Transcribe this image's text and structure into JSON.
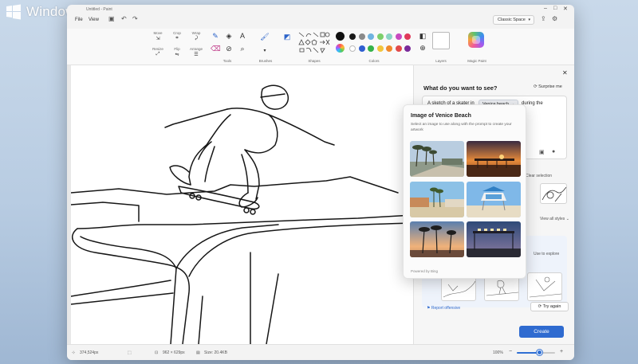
{
  "watermark": {
    "text": "Windows Central"
  },
  "titlebar": {
    "caption": "Untitled - Paint",
    "menu": [
      "File",
      "View"
    ],
    "mode": "Classic Space"
  },
  "ribbon": {
    "image_tools": [
      "Move",
      "Crop",
      "Wrap",
      "Resize",
      "Flip",
      "Arrange"
    ],
    "groups": {
      "tools": "Tools",
      "brushes": "Brushes",
      "shapes": "Shapes",
      "colors": "Colors",
      "layers": "Layers",
      "magic": "Magic Paint"
    },
    "colors_row1": [
      "#1a1a1a",
      "#8a8a8a",
      "#6fb3e0",
      "#7ccf6b",
      "#8bd4c5",
      "#c84ac0",
      "#e03a5a"
    ],
    "colors_row2": [
      "#ffffff",
      "#2f5fd0",
      "#35b24a",
      "#f2c53d",
      "#f08a2d",
      "#e24a4a",
      "#7a2a9a"
    ]
  },
  "canvas": {
    "subject": "line sketch of a skateboarder jumping at Venice beach skatepark"
  },
  "statusbar": {
    "cursor": "374,524px",
    "dimensions": "962 × 629px",
    "size": "Size: 20.4KB",
    "zoom": "100%",
    "zoom_level": 0.6
  },
  "panel": {
    "title": "What do you want to see?",
    "surprise": "Surprise me",
    "prompt_prefix": "A sketch of a skater in",
    "prompt_chip": "Venice beach",
    "prompt_suffix": "during the",
    "clear_selection": "Clear selection",
    "view_all_styles": "View all styles",
    "explore_hint": "Use to explore",
    "report": "Report offensive",
    "try_again": "Try again",
    "create": "Create"
  },
  "popup": {
    "title": "Image of Venice Beach",
    "subtitle": "Select an image to use along with the prompt to create your artwork",
    "footer": "Powered by Bing",
    "photos": [
      "palm-trees-beach-path",
      "sunset-pier",
      "beach-boardwalk",
      "lifeguard-tower",
      "palm-trees-sunset",
      "venice-sign-night"
    ]
  },
  "colors": {
    "accent": "#2f6bd0",
    "background": "#f3f3f3"
  }
}
